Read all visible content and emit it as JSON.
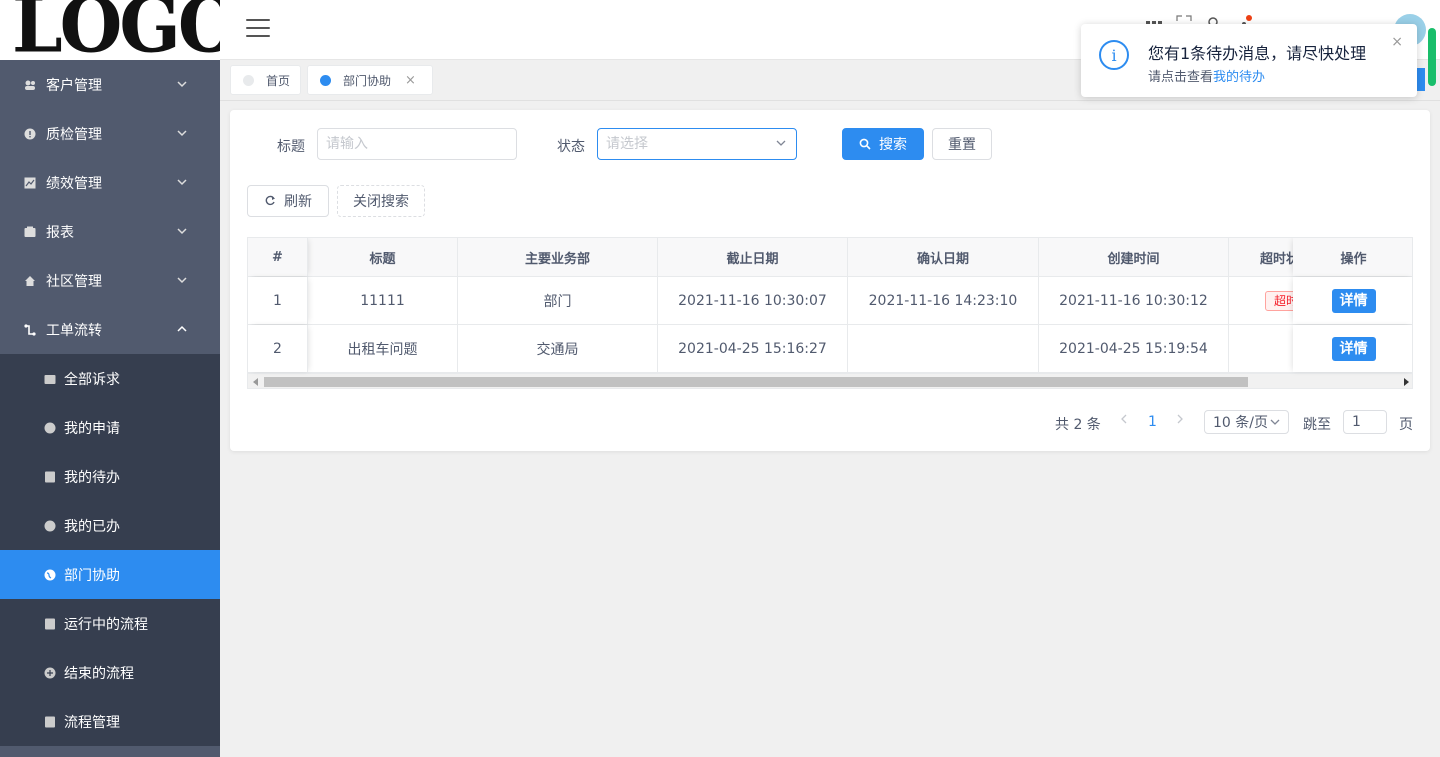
{
  "logo": "LOGO",
  "sidebar": {
    "menus": [
      {
        "label": "客户管理",
        "icon": "users-icon"
      },
      {
        "label": "质检管理",
        "icon": "alert-circle-icon"
      },
      {
        "label": "绩效管理",
        "icon": "chart-icon"
      },
      {
        "label": "报表",
        "icon": "report-icon"
      },
      {
        "label": "社区管理",
        "icon": "home-icon"
      },
      {
        "label": "工单流转",
        "icon": "workflow-icon"
      }
    ],
    "submenu": [
      {
        "label": "全部诉求",
        "icon": "folder-icon"
      },
      {
        "label": "我的申请",
        "icon": "clock-icon"
      },
      {
        "label": "我的待办",
        "icon": "document-icon"
      },
      {
        "label": "我的已办",
        "icon": "check-circle-icon"
      },
      {
        "label": "部门协助",
        "icon": "globe-icon"
      },
      {
        "label": "运行中的流程",
        "icon": "document-icon"
      },
      {
        "label": "结束的流程",
        "icon": "plus-circle-icon"
      },
      {
        "label": "流程管理",
        "icon": "document-icon"
      }
    ]
  },
  "tabs": [
    {
      "label": "首页"
    },
    {
      "label": "部门协助",
      "close": "×"
    }
  ],
  "search": {
    "title_label": "标题",
    "title_placeholder": "请输入",
    "status_label": "状态",
    "status_placeholder": "请选择",
    "search_button": "搜索",
    "reset_button": "重置",
    "refresh_button": "刷新",
    "toggle_search_button": "关闭搜索"
  },
  "table": {
    "columns": [
      "#",
      "标题",
      "主要业务部",
      "截止日期",
      "确认日期",
      "创建时间",
      "超时状",
      "操作"
    ],
    "rows": [
      {
        "index": "1",
        "title": "11111",
        "dept": "部门",
        "deadline": "2021-11-16 10:30:07",
        "confirm": "2021-11-16 14:23:10",
        "created": "2021-11-16 10:30:12",
        "overtime": "超时",
        "action": "详情"
      },
      {
        "index": "2",
        "title": "出租车问题",
        "dept": "交通局",
        "deadline": "2021-04-25 15:16:27",
        "confirm": "",
        "created": "2021-04-25 15:19:54",
        "overtime": "",
        "action": "详情"
      }
    ]
  },
  "pagination": {
    "total": "共 2 条",
    "current_page": "1",
    "page_size": "10 条/页",
    "jump_label": "跳至",
    "jump_value": "1",
    "page_suffix": "页"
  },
  "notification": {
    "title": "您有1条待办消息，请尽快处理",
    "desc_prefix": "请点击查看",
    "desc_link": "我的待办",
    "close": "×"
  },
  "colors": {
    "primary": "#2d8cf0",
    "sidebar": "#515a6e",
    "submenu": "#363e4f"
  }
}
